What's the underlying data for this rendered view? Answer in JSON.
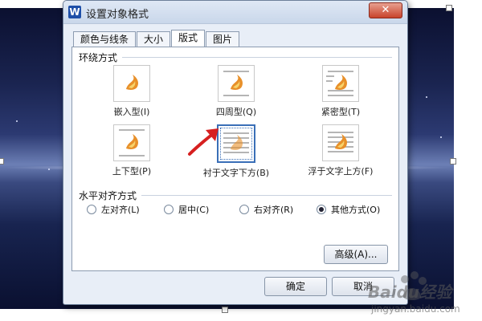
{
  "dialog": {
    "app_icon": "W",
    "title": "设置对象格式",
    "close": "✕"
  },
  "tabs": [
    {
      "label": "颜色与线条"
    },
    {
      "label": "大小"
    },
    {
      "label": "版式"
    },
    {
      "label": "图片"
    }
  ],
  "wrap": {
    "section_label": "环绕方式",
    "options": [
      {
        "label": "嵌入型(I)"
      },
      {
        "label": "四周型(Q)"
      },
      {
        "label": "紧密型(T)"
      },
      {
        "label": "上下型(P)"
      },
      {
        "label": "衬于文字下方(B)"
      },
      {
        "label": "浮于文字上方(F)"
      }
    ],
    "selected": "衬于文字下方(B)"
  },
  "align": {
    "section_label": "水平对齐方式",
    "options": [
      {
        "label": "左对齐(L)",
        "checked": false
      },
      {
        "label": "居中(C)",
        "checked": false
      },
      {
        "label": "右对齐(R)",
        "checked": false
      },
      {
        "label": "其他方式(O)",
        "checked": true
      }
    ]
  },
  "buttons": {
    "advanced": "高级(A)...",
    "ok": "确定",
    "cancel": "取消"
  },
  "watermark": {
    "brand": "Baidu经验",
    "url": "jingyan.baidu.com"
  },
  "colors": {
    "selected_border": "#3a6fb7",
    "arrow": "#d62020",
    "flame": "#e8902a"
  }
}
